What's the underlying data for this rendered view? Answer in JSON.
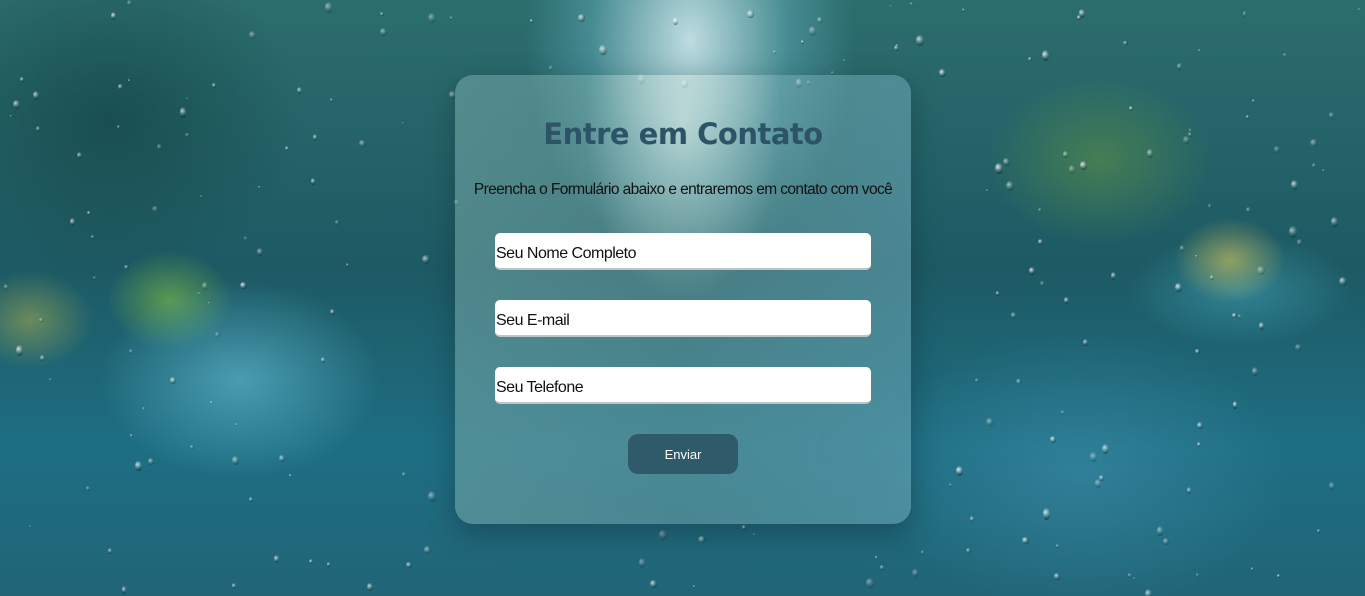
{
  "form": {
    "title": "Entre em Contato",
    "subtitle": "Preencha o Formulário abaixo e entraremos em contato com você",
    "fields": [
      {
        "placeholder": "Seu Nome Completo",
        "value": ""
      },
      {
        "placeholder": "Seu E-mail",
        "value": ""
      },
      {
        "placeholder": "Seu Telefone",
        "value": ""
      }
    ],
    "submit_label": "Enviar"
  },
  "colors": {
    "title": "#2c5466",
    "button": "#2e5a6a",
    "button_text": "#ffffff"
  }
}
